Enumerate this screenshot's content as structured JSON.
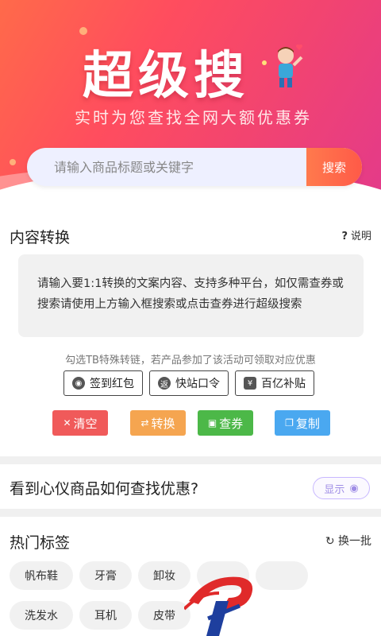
{
  "hero": {
    "title": "超级搜",
    "subtitle": "实时为您查找全网大额优惠券"
  },
  "search": {
    "placeholder": "请输入商品标题或关键字",
    "button_label": "搜索"
  },
  "content_convert": {
    "title": "内容转换",
    "help_label": "说明",
    "textarea_placeholder": "请输入要1:1转换的文案内容、支持多种平台，如仅需查券或搜索请使用上方输入框搜索或点击查券进行超级搜索",
    "hint": "勾选TB特殊转链，若产品参加了该活动可领取对应优惠",
    "options": [
      {
        "label": "签到红包",
        "icon": "wallet-icon"
      },
      {
        "label": "快站口令",
        "icon": "return-icon"
      },
      {
        "label": "百亿补贴",
        "icon": "subsidy-icon"
      }
    ],
    "actions": [
      {
        "label": "清空",
        "color": "#f05a5a"
      },
      {
        "label": "转换",
        "color": "#f5a550"
      },
      {
        "label": "查券",
        "color": "#4cb848"
      },
      {
        "label": "复制",
        "color": "#4aa8f0"
      }
    ]
  },
  "how_to": {
    "title": "看到心仪商品如何查找优惠?",
    "show_label": "显示"
  },
  "hot_tags": {
    "title": "热门标签",
    "refresh_label": "换一批",
    "tags": [
      "帆布鞋",
      "牙膏",
      "卸妆",
      "",
      "",
      "洗发水",
      "耳机",
      "皮带"
    ]
  }
}
